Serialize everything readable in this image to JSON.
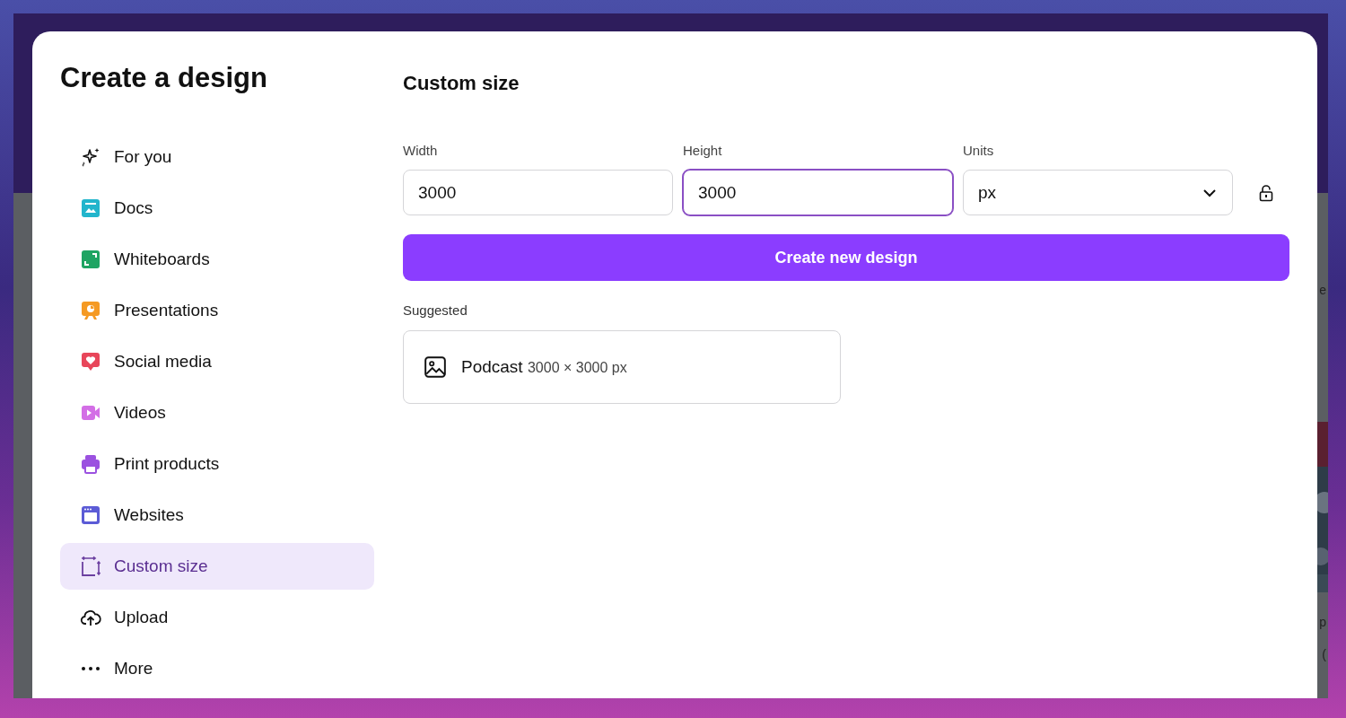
{
  "dialog": {
    "title": "Create a design",
    "categories": [
      {
        "label": "For you",
        "kind": "sparkles",
        "selected": false
      },
      {
        "label": "Docs",
        "kind": "docs",
        "selected": false
      },
      {
        "label": "Whiteboards",
        "kind": "whiteboards",
        "selected": false
      },
      {
        "label": "Presentations",
        "kind": "presentations",
        "selected": false
      },
      {
        "label": "Social media",
        "kind": "social",
        "selected": false
      },
      {
        "label": "Videos",
        "kind": "videos",
        "selected": false
      },
      {
        "label": "Print products",
        "kind": "print",
        "selected": false
      },
      {
        "label": "Websites",
        "kind": "websites",
        "selected": false
      },
      {
        "label": "Custom size",
        "kind": "custom",
        "selected": true
      },
      {
        "label": "Upload",
        "kind": "upload",
        "selected": false
      },
      {
        "label": "More",
        "kind": "more",
        "selected": false
      }
    ],
    "section_title": "Custom size",
    "fields": [
      {
        "label": "Width",
        "value": "3000",
        "focused": false
      },
      {
        "label": "Height",
        "value": "3000",
        "focused": true
      }
    ],
    "units": {
      "label": "Units",
      "value": "px"
    },
    "aspect_locked": false,
    "create_button": "Create new design",
    "suggested": {
      "heading": "Suggested",
      "items": [
        {
          "name": "Podcast",
          "size": "3000 × 3000 px"
        }
      ]
    }
  },
  "background": {
    "texts": [
      "e",
      "p",
      "("
    ]
  }
}
